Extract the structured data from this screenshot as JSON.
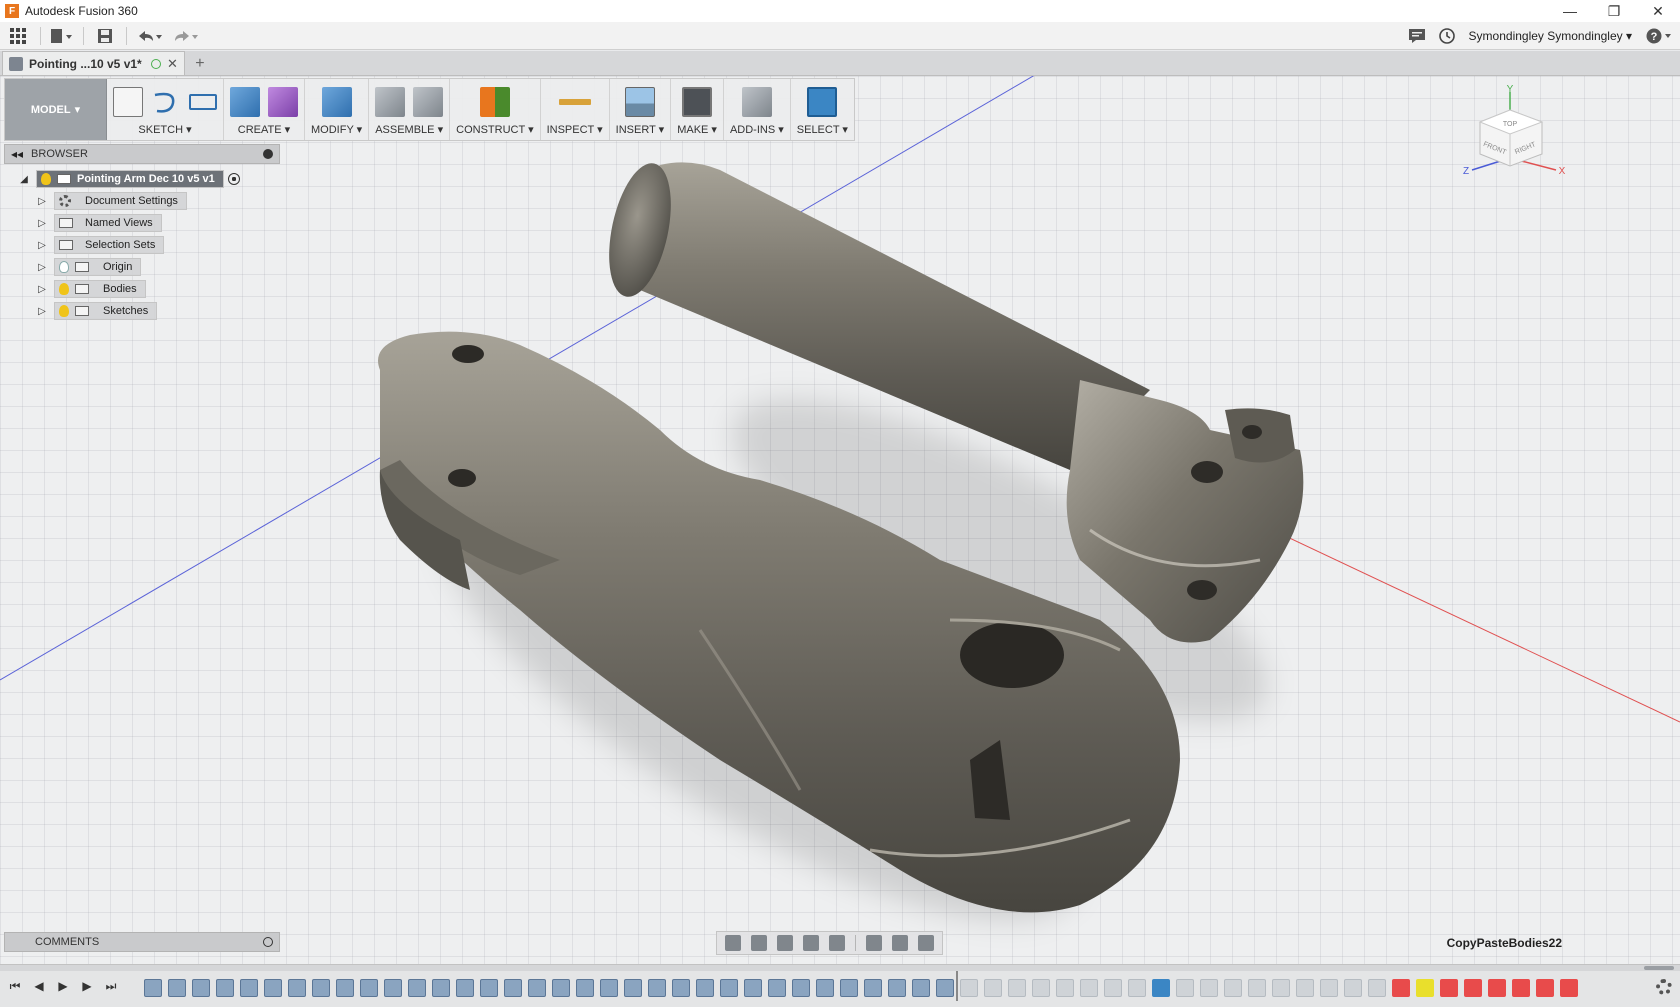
{
  "app": {
    "title": "Autodesk Fusion 360",
    "logo_letter": "F"
  },
  "window_controls": {
    "minimize": "—",
    "restore": "❐",
    "close": "✕"
  },
  "qat": {
    "user_name": "Symondingley Symondingley",
    "help": "?"
  },
  "document_tab": {
    "label": "Pointing ...10 v5 v1*",
    "close": "✕",
    "new_tab": "+"
  },
  "ribbon": {
    "mode": "MODEL",
    "groups": [
      {
        "label": "SKETCH"
      },
      {
        "label": "CREATE"
      },
      {
        "label": "MODIFY"
      },
      {
        "label": "ASSEMBLE"
      },
      {
        "label": "CONSTRUCT"
      },
      {
        "label": "INSPECT"
      },
      {
        "label": "INSERT"
      },
      {
        "label": "MAKE"
      },
      {
        "label": "ADD-INS"
      },
      {
        "label": "SELECT"
      }
    ]
  },
  "browser": {
    "title": "BROWSER",
    "root": "Pointing Arm Dec 10 v5 v1",
    "items": [
      {
        "label": "Document Settings"
      },
      {
        "label": "Named Views"
      },
      {
        "label": "Selection Sets"
      },
      {
        "label": "Origin"
      },
      {
        "label": "Bodies"
      },
      {
        "label": "Sketches"
      }
    ]
  },
  "comments": {
    "title": "COMMENTS"
  },
  "viewcube": {
    "top": "TOP",
    "front": "FRONT",
    "right": "RIGHT",
    "axis_x": "X",
    "axis_y": "Y",
    "axis_z": "Z"
  },
  "plugin_label": "CopyPasteBodies22",
  "colors": {
    "accent_blue": "#3b86c4",
    "timeline_red": "#e84b4b",
    "timeline_yellow": "#e9df2c",
    "model_gray": "#7d7a72"
  }
}
